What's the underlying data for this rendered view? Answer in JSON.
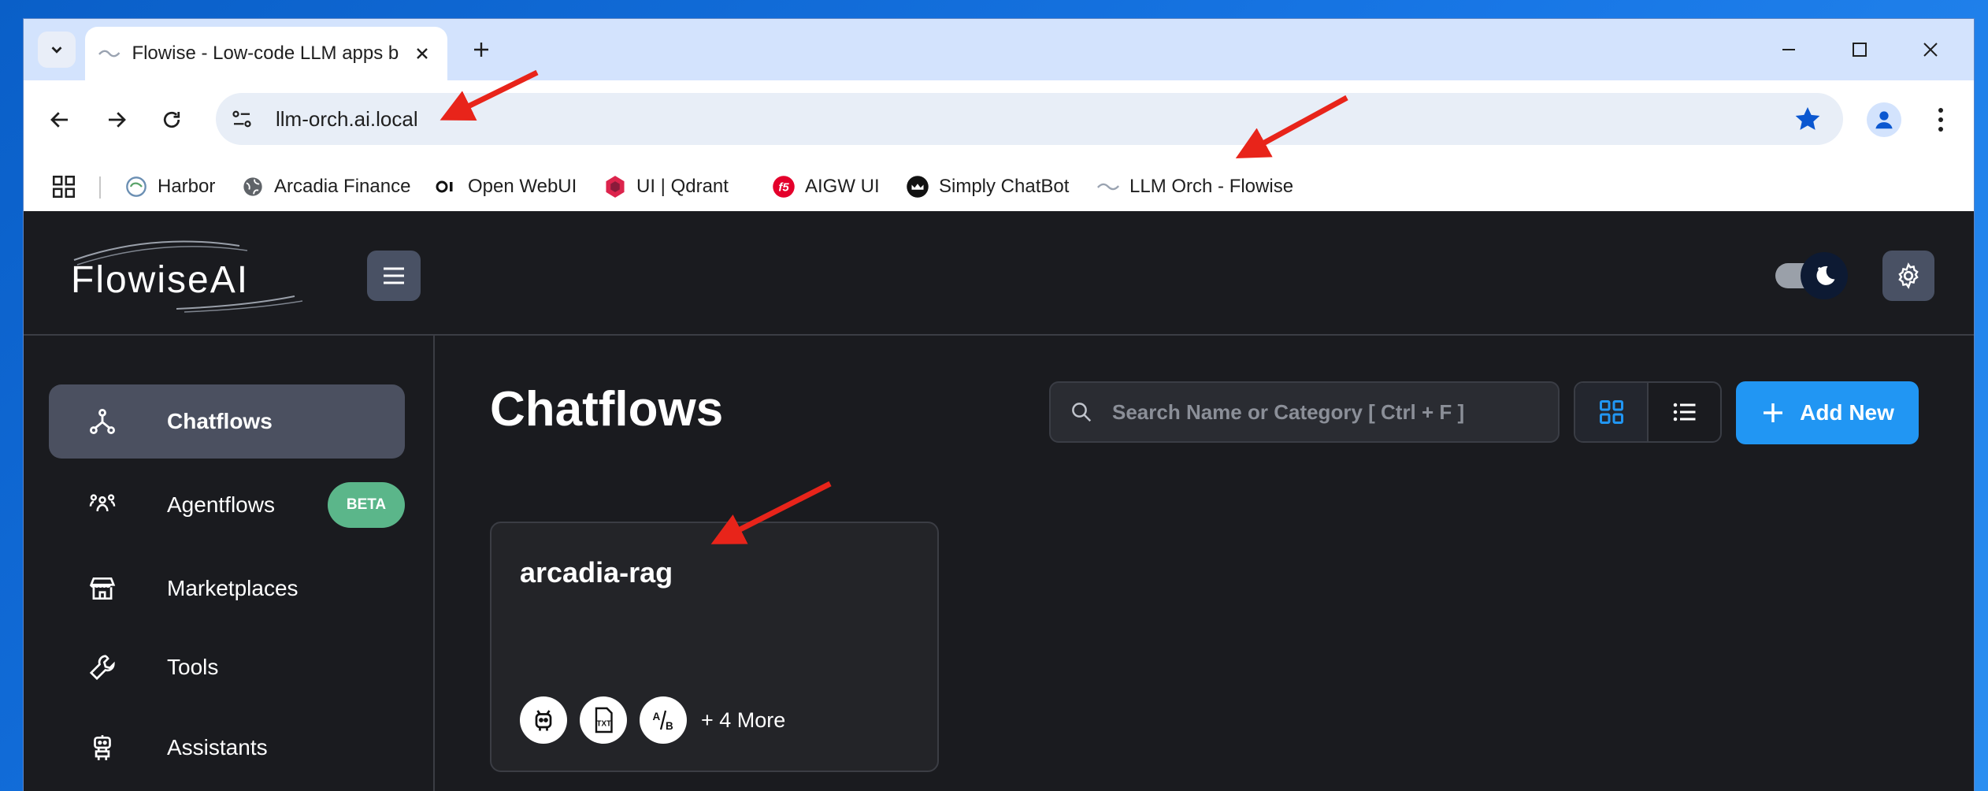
{
  "browser": {
    "tab_title": "Flowise - Low-code LLM apps b",
    "url": "llm-orch.ai.local",
    "bookmarks": [
      {
        "label": "Harbor",
        "icon": "harbor-icon"
      },
      {
        "label": "Arcadia Finance",
        "icon": "globe-icon"
      },
      {
        "label": "Open WebUI",
        "icon": "openwebui-icon"
      },
      {
        "label": "UI | Qdrant",
        "icon": "qdrant-icon"
      },
      {
        "label": "AIGW UI",
        "icon": "f5-icon"
      },
      {
        "label": "Simply ChatBot",
        "icon": "chatbot-icon"
      },
      {
        "label": "LLM Orch - Flowise",
        "icon": "flowise-icon"
      }
    ],
    "colors": {
      "tabstrip": "#d3e3fd",
      "star": "#0b57d0"
    }
  },
  "app": {
    "logo": "FlowiseAI",
    "sidebar": {
      "items": [
        {
          "label": "Chatflows",
          "icon": "chatflows-icon",
          "active": true
        },
        {
          "label": "Agentflows",
          "icon": "agentflows-icon",
          "badge": "BETA"
        },
        {
          "label": "Marketplaces",
          "icon": "marketplace-icon"
        },
        {
          "label": "Tools",
          "icon": "tools-icon"
        },
        {
          "label": "Assistants",
          "icon": "robot-icon"
        }
      ]
    },
    "main": {
      "title": "Chatflows",
      "search_placeholder": "Search Name or Category [ Ctrl + F ]",
      "add_label": "Add New",
      "cards": [
        {
          "title": "arcadia-rag",
          "node_icons": [
            "robot-node-icon",
            "txt-file-icon",
            "ab-icon"
          ],
          "more": "+ 4 More"
        }
      ]
    },
    "colors": {
      "primary": "#2196f3",
      "beta": "#5bb68a",
      "background": "#1a1b1f"
    }
  }
}
